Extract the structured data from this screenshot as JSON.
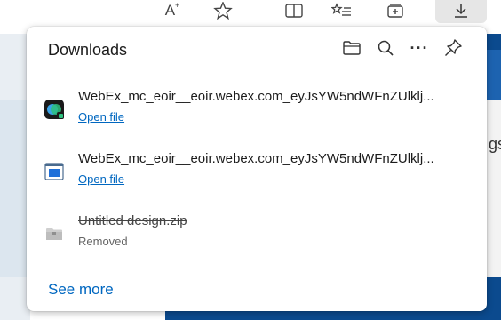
{
  "toolbar": {
    "icons": [
      "font-size-icon",
      "favorite-star-icon",
      "split-screen-icon",
      "favorites-list-icon",
      "collections-icon",
      "downloads-icon"
    ],
    "font_glyph": "A"
  },
  "downloads": {
    "title": "Downloads",
    "actions": [
      "open-folder-icon",
      "search-icon",
      "more-options-icon",
      "pin-icon"
    ],
    "more_glyph": "···",
    "items": [
      {
        "name": "WebEx_mc_eoir__eoir.webex.com_eyJsYW5ndWFnZUlklj...",
        "action": "Open file",
        "icon": "webex-app-icon"
      },
      {
        "name": "WebEx_mc_eoir__eoir.webex.com_eyJsYW5ndWFnZUlklj...",
        "action": "Open file",
        "icon": "installer-window-icon"
      },
      {
        "name": "Untitled design.zip",
        "status": "Removed",
        "icon": "zip-archive-icon"
      }
    ],
    "see_more": "See more"
  },
  "page_behind": {
    "partial_text": "gs"
  },
  "colors": {
    "link": "#0067c0",
    "page_blue": "#0b4a8e",
    "webex_green": "#2ec27e"
  }
}
